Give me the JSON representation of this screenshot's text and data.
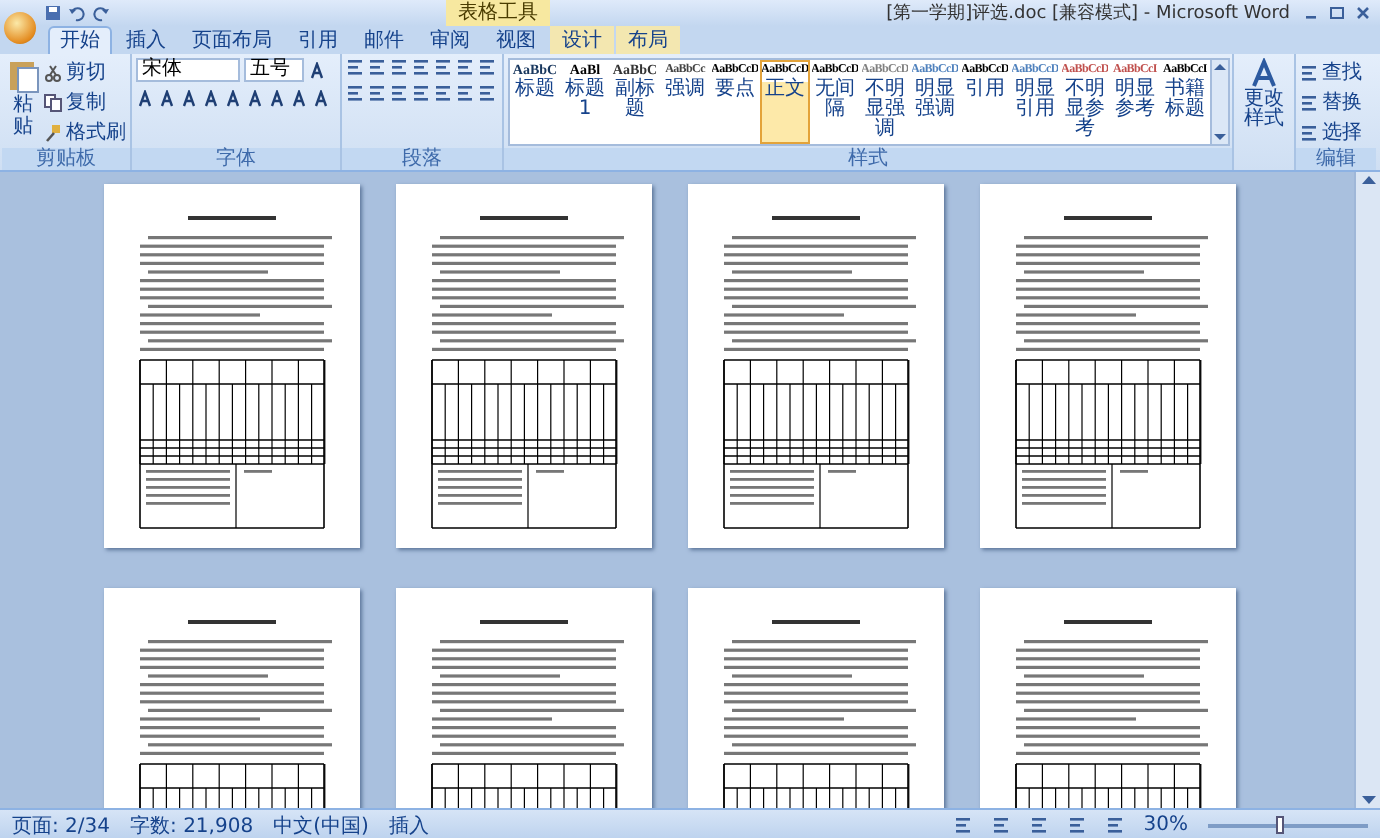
{
  "title_bar": {
    "title": "[第一学期]评选.doc [兼容模式] - Microsoft Word",
    "context_group": "表格工具"
  },
  "tabs": [
    {
      "label": "开始",
      "selected": true,
      "contextual": false
    },
    {
      "label": "插入",
      "selected": false,
      "contextual": false
    },
    {
      "label": "页面布局",
      "selected": false,
      "contextual": false
    },
    {
      "label": "引用",
      "selected": false,
      "contextual": false
    },
    {
      "label": "邮件",
      "selected": false,
      "contextual": false
    },
    {
      "label": "审阅",
      "selected": false,
      "contextual": false
    },
    {
      "label": "视图",
      "selected": false,
      "contextual": false
    },
    {
      "label": "设计",
      "selected": false,
      "contextual": true
    },
    {
      "label": "布局",
      "selected": false,
      "contextual": true
    }
  ],
  "clipboard": {
    "paste": "粘贴",
    "cut": "剪切",
    "copy": "复制",
    "format_painter": "格式刷",
    "label": "剪贴板"
  },
  "font": {
    "name": "宋体",
    "size": "五号",
    "label": "字体"
  },
  "paragraph": {
    "label": "段落"
  },
  "styles": {
    "label": "样式",
    "items": [
      {
        "preview": "AaBbC",
        "label": "标题",
        "kind": "heading",
        "selected": false,
        "color": "#17365d"
      },
      {
        "preview": "AaBl",
        "label": "标题 1",
        "kind": "heading",
        "selected": false,
        "color": "#000000"
      },
      {
        "preview": "AaBbC",
        "label": "副标题",
        "kind": "heading",
        "selected": false,
        "color": "#333333"
      },
      {
        "preview": "AaBbCc",
        "label": "强调",
        "kind": "body",
        "selected": false,
        "color": "#444444"
      },
      {
        "preview": "AaBbCcD",
        "label": "要点",
        "kind": "body",
        "selected": false,
        "color": "#000000"
      },
      {
        "preview": "AaBbCcD",
        "label": "正文",
        "kind": "body",
        "selected": true,
        "color": "#000000"
      },
      {
        "preview": "AaBbCcD",
        "label": "无间隔",
        "kind": "body",
        "selected": false,
        "color": "#000000"
      },
      {
        "preview": "AaBbCcD",
        "label": "不明显强调",
        "kind": "body",
        "selected": false,
        "color": "#808080"
      },
      {
        "preview": "AaBbCcD",
        "label": "明显强调",
        "kind": "body",
        "selected": false,
        "color": "#4f81bd"
      },
      {
        "preview": "AaBbCcD",
        "label": "引用",
        "kind": "body",
        "selected": false,
        "color": "#000000"
      },
      {
        "preview": "AaBbCcD",
        "label": "明显引用",
        "kind": "body",
        "selected": false,
        "color": "#4f81bd"
      },
      {
        "preview": "AaBbCcD",
        "label": "不明显参考",
        "kind": "body",
        "selected": false,
        "color": "#c0504d"
      },
      {
        "preview": "AaBbCcI",
        "label": "明显参考",
        "kind": "body",
        "selected": false,
        "color": "#c0504d"
      },
      {
        "preview": "AaBbCcI",
        "label": "书籍标题",
        "kind": "body",
        "selected": false,
        "color": "#000000"
      }
    ]
  },
  "change_styles": "更改样式",
  "editing": {
    "label": "编辑",
    "items": [
      "查找",
      "替换",
      "选择"
    ]
  },
  "status_bar": {
    "page": "页面: 2/34",
    "words": "字数: 21,908",
    "language": "中文(中国)",
    "mode": "插入",
    "zoom": "30%",
    "zoom_slider": {
      "level": 0.45
    }
  }
}
